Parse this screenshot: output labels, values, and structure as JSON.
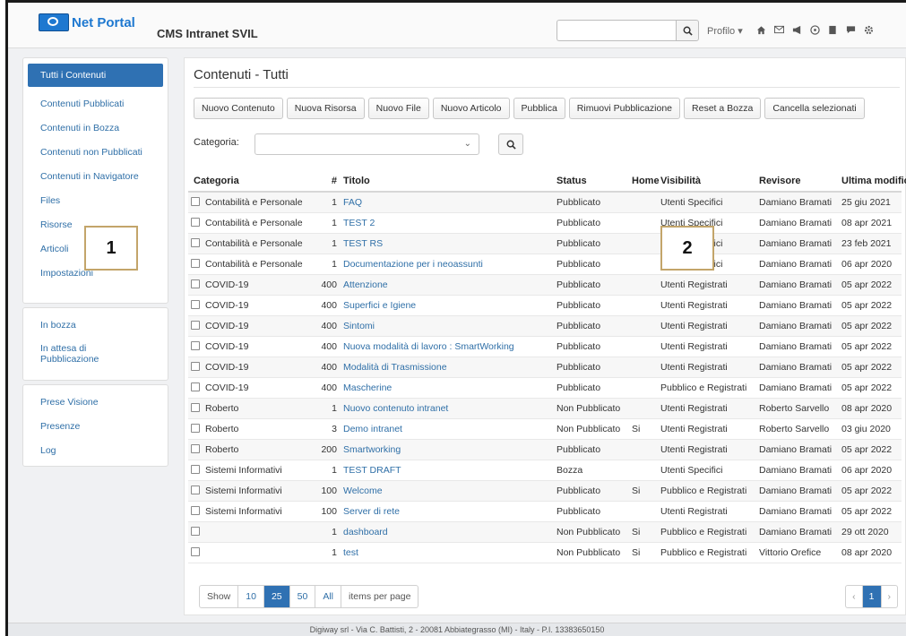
{
  "header": {
    "logo_text": "Net Portal",
    "app_title": "CMS Intranet SVIL",
    "search_value": "",
    "profile_label": "Profilo",
    "icons": [
      "home-icon",
      "mail-icon",
      "megaphone-icon",
      "compass-icon",
      "book-icon",
      "chat-icon",
      "gear-icon"
    ]
  },
  "sidebar": {
    "main": [
      "Tutti i Contenuti",
      "Contenuti Pubblicati",
      "Contenuti in Bozza",
      "Contenuti non Pubblicati",
      "Contenuti in Navigatore",
      "Files",
      "Risorse",
      "Articoli",
      "Impostazioni"
    ],
    "workflow": [
      "In bozza",
      "In attesa di Pubblicazione"
    ],
    "other": [
      "Prese Visione",
      "Presenze",
      "Log"
    ]
  },
  "callouts": {
    "one": "1",
    "two": "2"
  },
  "main": {
    "title": "Contenuti - Tutti",
    "toolbar": [
      "Nuovo Contenuto",
      "Nuova Risorsa",
      "Nuovo File",
      "Nuovo Articolo",
      "Pubblica",
      "Rimuovi Pubblicazione",
      "Reset a Bozza",
      "Cancella selezionati"
    ],
    "category_label": "Categoria:",
    "category_value": ""
  },
  "table": {
    "columns": [
      "Categoria",
      "#",
      "Titolo",
      "Status",
      "Home",
      "Visibilità",
      "Revisore",
      "Ultima modifica"
    ],
    "rows": [
      [
        "Contabilità e Personale",
        "1",
        "FAQ",
        "Pubblicato",
        "",
        "Utenti Specifici",
        "Damiano Bramati",
        "25 giu 2021"
      ],
      [
        "Contabilità e Personale",
        "1",
        "TEST 2",
        "Pubblicato",
        "",
        "Utenti Specifici",
        "Damiano Bramati",
        "08 apr 2021"
      ],
      [
        "Contabilità e Personale",
        "1",
        "TEST RS",
        "Pubblicato",
        "",
        "Utenti Specifici",
        "Damiano Bramati",
        "23 feb 2021"
      ],
      [
        "Contabilità e Personale",
        "1",
        "Documentazione per i neoassunti",
        "Pubblicato",
        "",
        "Utenti Specifici",
        "Damiano Bramati",
        "06 apr 2020"
      ],
      [
        "COVID-19",
        "400",
        "Attenzione",
        "Pubblicato",
        "",
        "Utenti Registrati",
        "Damiano Bramati",
        "05 apr 2022"
      ],
      [
        "COVID-19",
        "400",
        "Superfici e Igiene",
        "Pubblicato",
        "",
        "Utenti Registrati",
        "Damiano Bramati",
        "05 apr 2022"
      ],
      [
        "COVID-19",
        "400",
        "Sintomi",
        "Pubblicato",
        "",
        "Utenti Registrati",
        "Damiano Bramati",
        "05 apr 2022"
      ],
      [
        "COVID-19",
        "400",
        "Nuova modalità di lavoro : SmartWorking",
        "Pubblicato",
        "",
        "Utenti Registrati",
        "Damiano Bramati",
        "05 apr 2022"
      ],
      [
        "COVID-19",
        "400",
        "Modalità di Trasmissione",
        "Pubblicato",
        "",
        "Utenti Registrati",
        "Damiano Bramati",
        "05 apr 2022"
      ],
      [
        "COVID-19",
        "400",
        "Mascherine",
        "Pubblicato",
        "",
        "Pubblico e Registrati",
        "Damiano Bramati",
        "05 apr 2022"
      ],
      [
        "Roberto",
        "1",
        "Nuovo contenuto intranet",
        "Non Pubblicato",
        "",
        "Utenti Registrati",
        "Roberto Sarvello",
        "08 apr 2020"
      ],
      [
        "Roberto",
        "3",
        "Demo intranet",
        "Non Pubblicato",
        "Si",
        "Utenti Registrati",
        "Roberto Sarvello",
        "03 giu 2020"
      ],
      [
        "Roberto",
        "200",
        "Smartworking",
        "Pubblicato",
        "",
        "Utenti Registrati",
        "Damiano Bramati",
        "05 apr 2022"
      ],
      [
        "Sistemi Informativi",
        "1",
        "TEST DRAFT",
        "Bozza",
        "",
        "Utenti Specifici",
        "Damiano Bramati",
        "06 apr 2020"
      ],
      [
        "Sistemi Informativi",
        "100",
        "Welcome",
        "Pubblicato",
        "Si",
        "Pubblico e Registrati",
        "Damiano Bramati",
        "05 apr 2022"
      ],
      [
        "Sistemi Informativi",
        "100",
        "Server di rete",
        "Pubblicato",
        "",
        "Utenti Registrati",
        "Damiano Bramati",
        "05 apr 2022"
      ],
      [
        "",
        "1",
        "dashboard",
        "Non Pubblicato",
        "Si",
        "Pubblico e Registrati",
        "Damiano Bramati",
        "29 ott 2020"
      ],
      [
        "",
        "1",
        "test",
        "Non Pubblicato",
        "Si",
        "Pubblico e Registrati",
        "Vittorio Orefice",
        "08 apr 2020"
      ]
    ]
  },
  "pagination": {
    "show_label": "Show",
    "sizes": [
      "10",
      "25",
      "50",
      "All"
    ],
    "active_size": "25",
    "per_page_label": "items per page",
    "prev": "‹",
    "current_page": "1",
    "next": "›"
  },
  "footer": {
    "text": "Digiway srl - Via C. Battisti, 2 - 20081 Abbiategrasso (MI) - Italy - P.I. 13383650150"
  },
  "colors": {
    "accent": "#2f71b3",
    "link": "#2f6fa7",
    "callout_border": "#c3a56a"
  }
}
